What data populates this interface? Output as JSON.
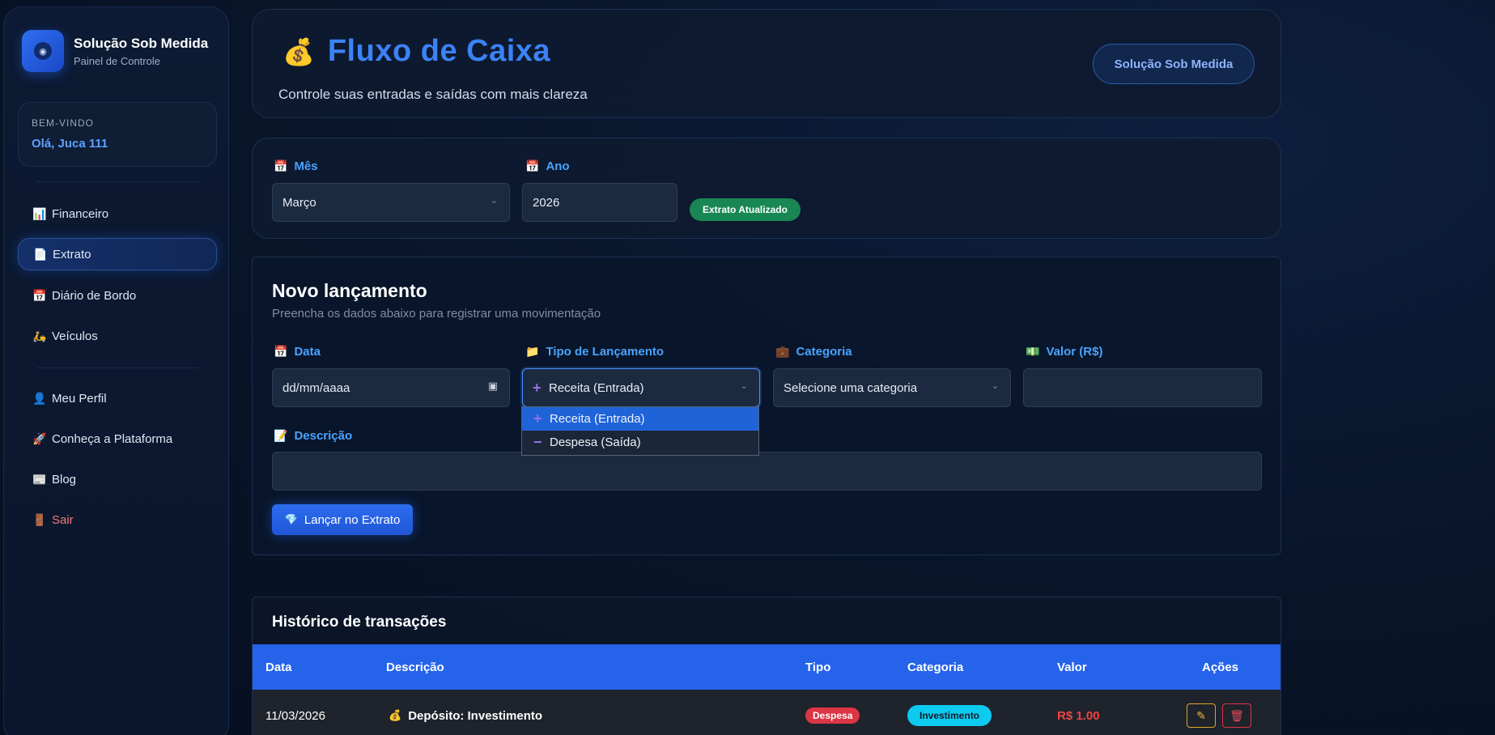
{
  "sidebar": {
    "brand_title": "Solução Sob Medida",
    "brand_subtitle": "Painel de Controle",
    "welcome_label": "BEM-VINDO",
    "welcome_name": "Olá, Juca 111",
    "items": [
      {
        "label": "Financeiro",
        "icon": "bar-chart-icon",
        "glyph": "📊"
      },
      {
        "label": "Extrato",
        "icon": "document-icon",
        "glyph": "📄"
      },
      {
        "label": "Diário de Bordo",
        "icon": "calendar-icon",
        "glyph": "📅"
      },
      {
        "label": "Veículos",
        "icon": "vehicle-icon",
        "glyph": "🛵"
      },
      {
        "label": "Meu Perfil",
        "icon": "user-icon",
        "glyph": "👤"
      },
      {
        "label": "Conheça a Plataforma",
        "icon": "rocket-icon",
        "glyph": "🚀"
      },
      {
        "label": "Blog",
        "icon": "newspaper-icon",
        "glyph": "📰"
      },
      {
        "label": "Sair",
        "icon": "door-icon",
        "glyph": "🚪"
      }
    ],
    "active_item": "Extrato"
  },
  "header": {
    "title_icon": "money-bag-icon",
    "title_glyph": "💰",
    "title": "Fluxo de Caixa",
    "subtitle": "Controle suas entradas e saídas com mais clareza",
    "brand_button": "Solução Sob Medida"
  },
  "filters": {
    "month_label": "Mês",
    "month_value": "Março",
    "year_label": "Ano",
    "year_value": "2026",
    "status_badge": "Extrato Atualizado"
  },
  "entry_form": {
    "title": "Novo lançamento",
    "subtitle": "Preencha os dados abaixo para registrar uma movimentação",
    "date_label": "Data",
    "date_placeholder": "dd/mm/aaaa",
    "type_label": "Tipo de Lançamento",
    "type_value": "Receita (Entrada)",
    "type_options": [
      "Receita (Entrada)",
      "Despesa (Saída)"
    ],
    "category_label": "Categoria",
    "category_placeholder": "Selecione uma categoria",
    "amount_label": "Valor (R$)",
    "amount_value": "",
    "description_label": "Descrição",
    "description_value": "",
    "submit_label": "Lançar no Extrato"
  },
  "history": {
    "title": "Histórico de transações",
    "columns": [
      "Data",
      "Descrição",
      "Tipo",
      "Categoria",
      "Valor",
      "Ações"
    ],
    "rows": [
      {
        "date": "11/03/2026",
        "description": "Depósito: Investimento",
        "description_icon": "money-bag-icon",
        "type": "Despesa",
        "category": "Investimento",
        "value": "R$ 1.00"
      }
    ]
  },
  "colors": {
    "accent": "#2563eb",
    "title_blue": "#3b82f6",
    "label_blue": "#4aa3ff",
    "success": "#198754",
    "danger": "#dc3545",
    "info": "#0dcaf0",
    "warning": "#e0a526"
  }
}
